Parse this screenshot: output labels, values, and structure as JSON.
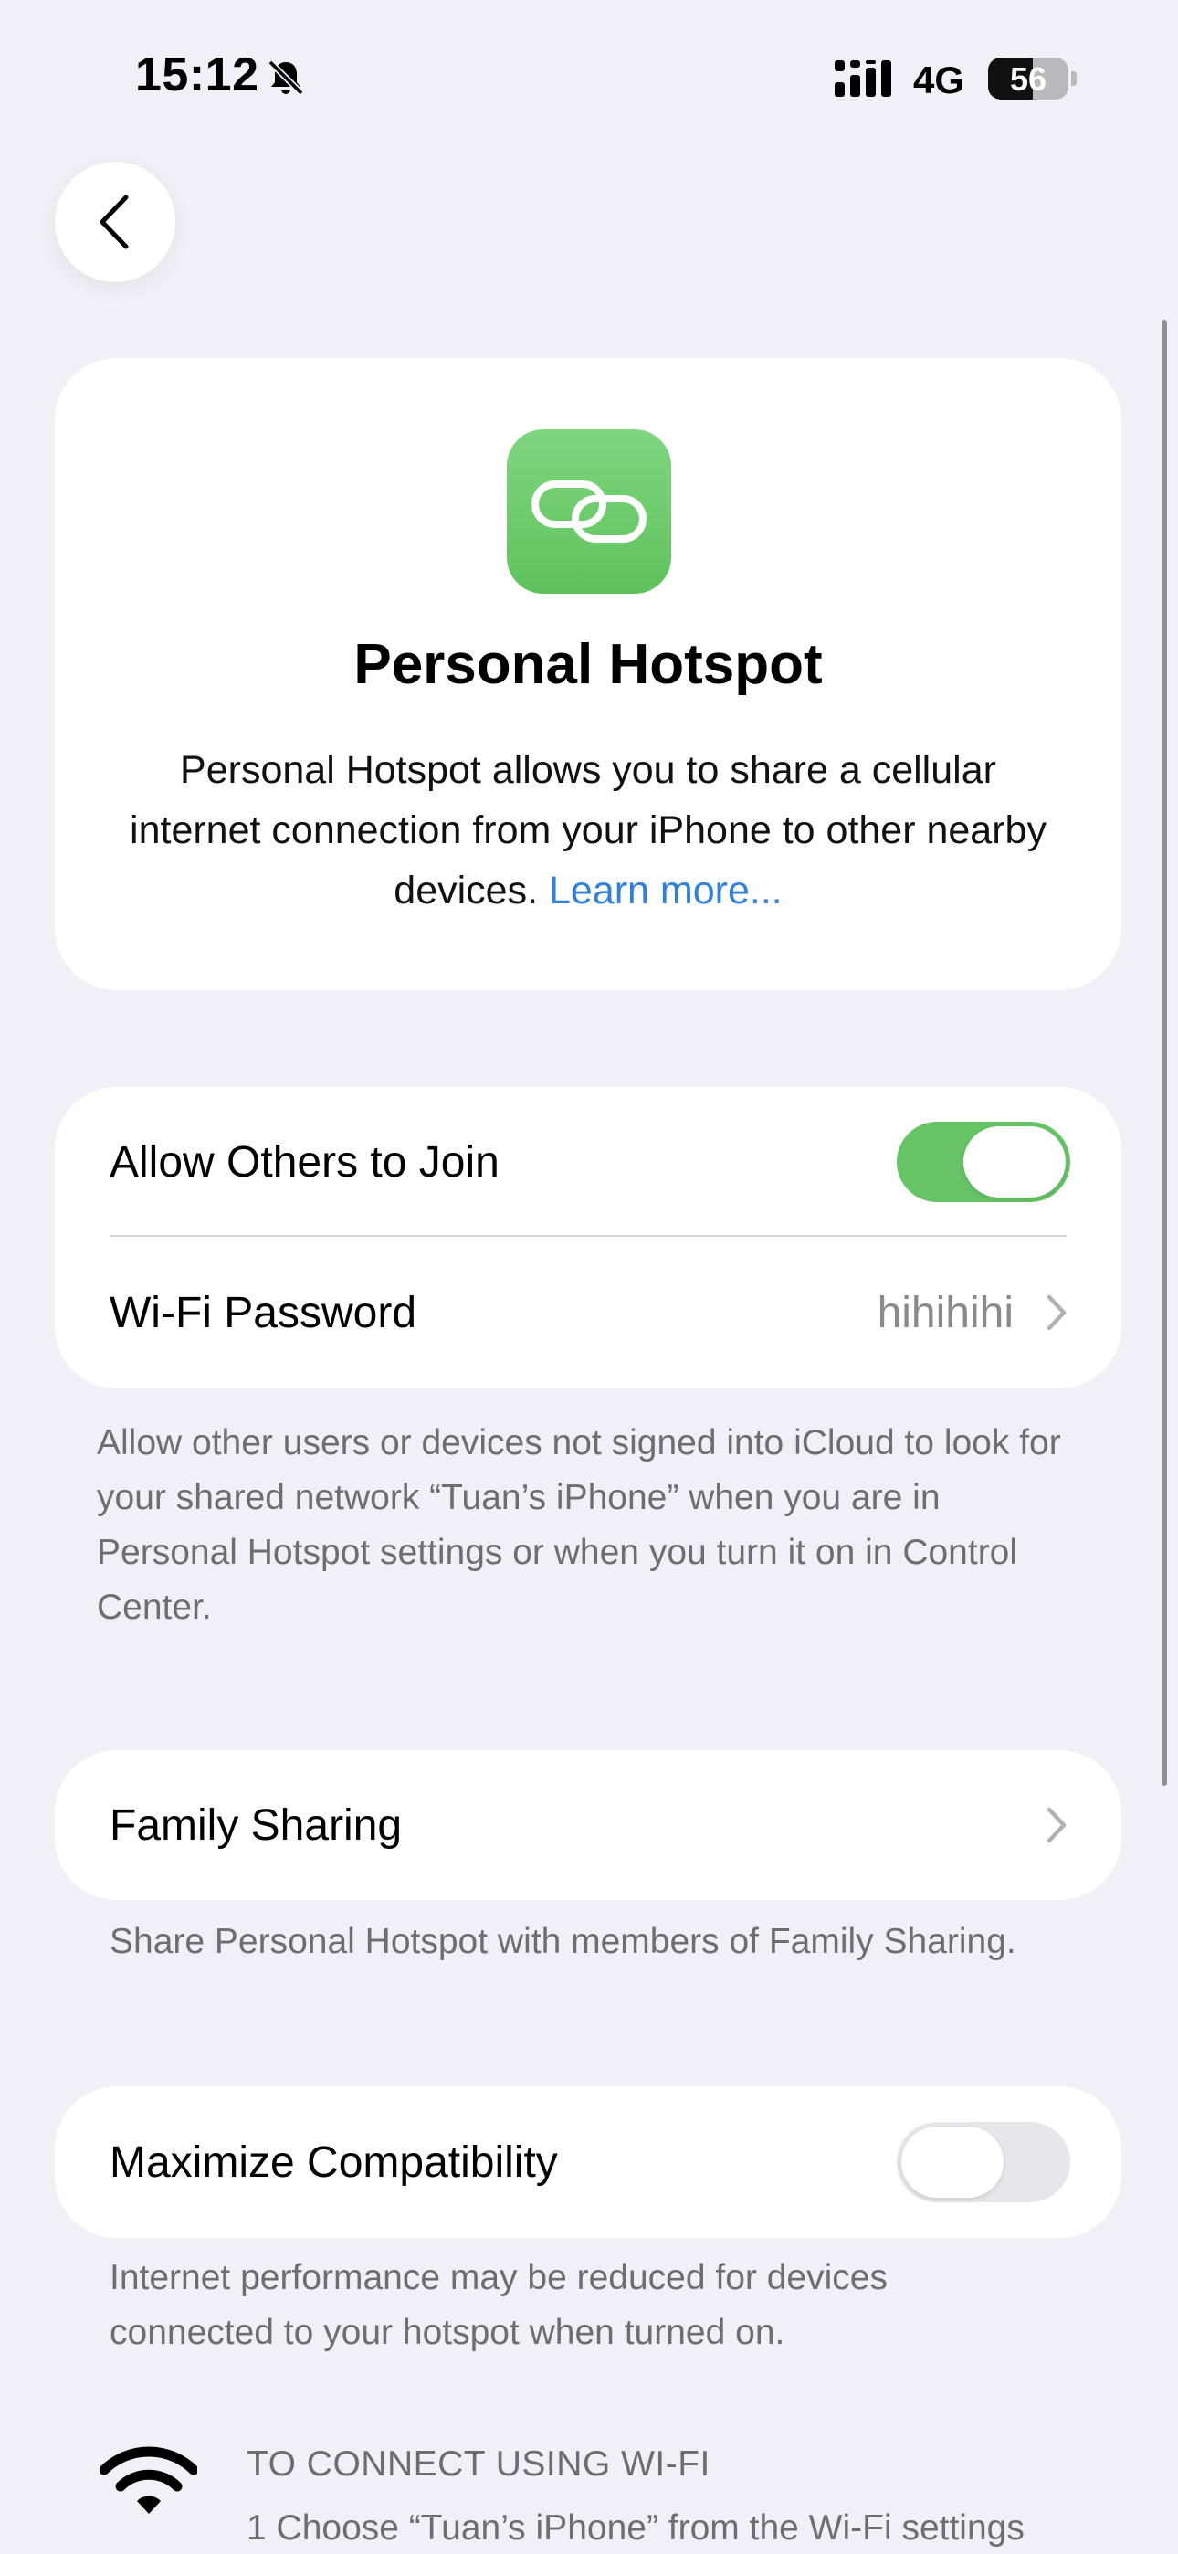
{
  "status_bar": {
    "time": "15:12",
    "network": "4G",
    "battery_level": "56",
    "battery_fraction": 0.56
  },
  "icons": {
    "back": "chevron-left-icon",
    "app": "link-icon",
    "silent": "bell-slash-icon",
    "wifi": "wifi-icon"
  },
  "colors": {
    "accent_green": "#65c466",
    "link_blue": "#2f7fe0",
    "background": "#f1f0f6"
  },
  "header": {
    "title": "Personal Hotspot",
    "description": "Personal Hotspot allows you to share a cellular internet connection from your iPhone to other nearby devices.",
    "learn_more": "Learn more..."
  },
  "allow_others": {
    "label": "Allow Others to Join",
    "enabled": true
  },
  "wifi_password": {
    "label": "Wi-Fi Password",
    "value": "hihihihi"
  },
  "allow_footnote": "Allow other users or devices not signed into iCloud to look for your shared network “Tuan’s iPhone” when you are in Personal Hotspot settings or when you turn it on in Control Center.",
  "family_sharing": {
    "label": "Family Sharing",
    "footnote": "Share Personal Hotspot with members of Family Sharing."
  },
  "maximize_compat": {
    "label": "Maximize Compatibility",
    "enabled": false,
    "footnote": "Internet performance may be reduced for devices connected to your hotspot when turned on."
  },
  "connect_wifi": {
    "heading": "TO CONNECT USING WI-FI",
    "step_1": "1 Choose “Tuan’s iPhone” from the Wi-Fi settings"
  }
}
